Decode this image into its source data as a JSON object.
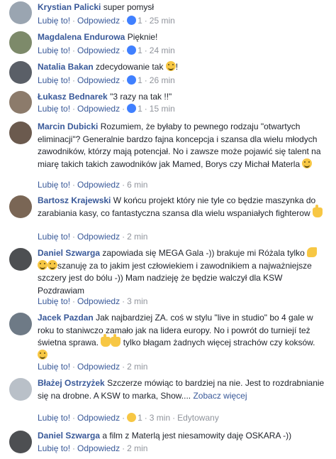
{
  "actions": {
    "like": "Lubię to!",
    "reply": "Odpowiedz",
    "separator": "·"
  },
  "colors": {
    "link": "#385898",
    "text": "#1d2129",
    "meta": "#90949c",
    "like_reaction": "#4080ff",
    "wow_reaction": "#f7c744"
  },
  "comments": [
    {
      "name": "Krystian Palicki",
      "text": "super pomysł",
      "reaction_icon": "like-reaction-icon",
      "reaction_count": "1",
      "time": "25 min"
    },
    {
      "name": "Magdalena Endurowa",
      "text": "Pięknie!",
      "reaction_icon": "like-reaction-icon",
      "reaction_count": "1",
      "time": "24 min"
    },
    {
      "name": "Natalia Bakan",
      "text": "zdecydowanie tak",
      "text_after": "!",
      "emoji": "smile-emoji-icon",
      "reaction_icon": "like-reaction-icon",
      "reaction_count": "1",
      "time": "26 min"
    },
    {
      "name": "Łukasz Bednarek",
      "text": "\"3 razy na tak !!\"",
      "reaction_icon": "like-reaction-icon",
      "reaction_count": "1",
      "time": "15 min"
    },
    {
      "name": "Marcin Dubicki",
      "text": "Rozumiem, że byłaby to pewnego rodzaju \"otwartych eliminacji\"? Generalnie bardzo fajna koncepcja i szansa dla wielu młodych zawodników, którzy mają potencjał. No i zawsze może pojawić się talent na miarę takich takich zawodników jak Mamed, Borys czy Michał Materla",
      "emoji": "wink-emoji-icon",
      "time": "6 min"
    },
    {
      "name": "Bartosz Krajewski",
      "text": "W końcu projekt który nie tyle co będzie maszynka do zarabiania kasy, co fantastyczna szansa dla wielu wspaniałych fighterow",
      "emoji": "pointing-hand-icon",
      "time": "2 min"
    },
    {
      "name": "Daniel Szwarga",
      "text_before": "zapowiada się MEGA Gala -)) brakuje mi Różala tylko",
      "emoji": "flexed-biceps-and-relieved-faces-icon",
      "text": "szanuję za to jakim jest człowiekiem i zawodnikiem a najważniejsze szczery jest do bólu -)) Mam nadzieję że będzie walczył dla KSW Pozdrawiam",
      "time": "3 min"
    },
    {
      "name": "Jacek Pazdan",
      "text": "Jak najbardziej ZA. coś w stylu \"live in studio\" bo 4 gale w roku to staniwczo zamało jak na lidera europy. No i powrót do turniejí też świetna sprawa.",
      "emoji": "pointing-hands-icon",
      "text_after": "tylko błagam żadnych więcej strachów czy koksów.",
      "emoji2": "smile-emoji-icon",
      "time": "2 min"
    },
    {
      "name": "Błażej Ostrzyżek",
      "text": "Szczerze mówiąc to bardziej na nie. Jest to rozdrabnianie się na drobne. A KSW to marka, Show....",
      "more": "Zobacz więcej",
      "reaction_icon": "wow-reaction-icon",
      "reaction_count": "1",
      "time": "3 min",
      "edited": "Edytowany"
    },
    {
      "name": "Daniel Szwarga",
      "text": "a film z Materlą jest niesamowity daję OSKARA -))",
      "time": "2 min"
    }
  ]
}
